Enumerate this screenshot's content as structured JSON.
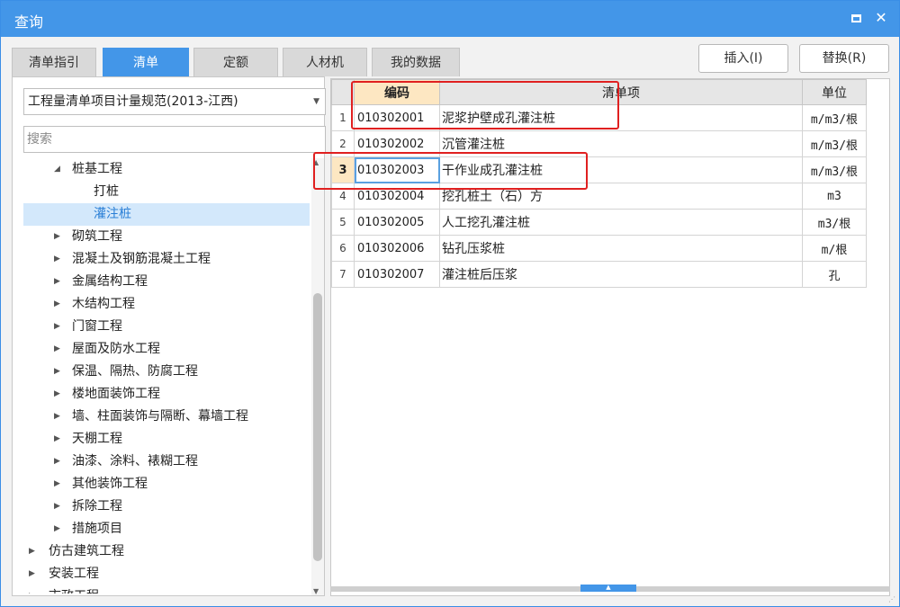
{
  "window": {
    "title": "查询",
    "maximize_label": "",
    "close_label": "✕"
  },
  "tabs": [
    {
      "label": "清单指引",
      "active": false
    },
    {
      "label": "清单",
      "active": true
    },
    {
      "label": "定额",
      "active": false
    },
    {
      "label": "人材机",
      "active": false
    },
    {
      "label": "我的数据",
      "active": false
    }
  ],
  "toolbar": {
    "insert_label": "插入(I)",
    "replace_label": "替换(R)"
  },
  "left": {
    "spec_select_value": "工程量清单项目计量规范(2013-江西)",
    "search_placeholder": "搜索",
    "tree": [
      {
        "label": "桩基工程",
        "expander": "◢",
        "selected": false
      },
      {
        "label": "打桩",
        "expander": "",
        "selected": false
      },
      {
        "label": "灌注桩",
        "expander": "",
        "selected": true
      },
      {
        "label": "砌筑工程",
        "expander": "▶",
        "selected": false
      },
      {
        "label": "混凝土及钢筋混凝土工程",
        "expander": "▶",
        "selected": false
      },
      {
        "label": "金属结构工程",
        "expander": "▶",
        "selected": false
      },
      {
        "label": "木结构工程",
        "expander": "▶",
        "selected": false
      },
      {
        "label": "门窗工程",
        "expander": "▶",
        "selected": false
      },
      {
        "label": "屋面及防水工程",
        "expander": "▶",
        "selected": false
      },
      {
        "label": "保温、隔热、防腐工程",
        "expander": "▶",
        "selected": false
      },
      {
        "label": "楼地面装饰工程",
        "expander": "▶",
        "selected": false
      },
      {
        "label": "墙、柱面装饰与隔断、幕墙工程",
        "expander": "▶",
        "selected": false
      },
      {
        "label": "天棚工程",
        "expander": "▶",
        "selected": false
      },
      {
        "label": "油漆、涂料、裱糊工程",
        "expander": "▶",
        "selected": false
      },
      {
        "label": "其他装饰工程",
        "expander": "▶",
        "selected": false
      },
      {
        "label": "拆除工程",
        "expander": "▶",
        "selected": false
      },
      {
        "label": "措施项目",
        "expander": "▶",
        "selected": false
      },
      {
        "label": "仿古建筑工程",
        "expander": "▶",
        "selected": false
      },
      {
        "label": "安装工程",
        "expander": "▶",
        "selected": false
      },
      {
        "label": "市政工程",
        "expander": "▶",
        "selected": false
      }
    ]
  },
  "table": {
    "columns": {
      "code": "编码",
      "name": "清单项",
      "unit": "单位"
    },
    "current_row": 3,
    "rows": [
      {
        "index": "1",
        "code": "010302001",
        "name": "泥浆护壁成孔灌注桩",
        "unit": "m/m3/根"
      },
      {
        "index": "2",
        "code": "010302002",
        "name": "沉管灌注桩",
        "unit": "m/m3/根"
      },
      {
        "index": "3",
        "code": "010302003",
        "name": "干作业成孔灌注桩",
        "unit": "m/m3/根"
      },
      {
        "index": "4",
        "code": "010302004",
        "name": "挖孔桩土（石）方",
        "unit": "m3"
      },
      {
        "index": "5",
        "code": "010302005",
        "name": "人工挖孔灌注桩",
        "unit": "m3/根"
      },
      {
        "index": "6",
        "code": "010302006",
        "name": "钻孔压浆桩",
        "unit": "m/根"
      },
      {
        "index": "7",
        "code": "010302007",
        "name": "灌注桩后压浆",
        "unit": "孔"
      }
    ]
  },
  "colors": {
    "titlebar": "#4396e8",
    "active_tab": "#4396e8",
    "highlight_border": "#e02020",
    "current_cell": "#fde7c2",
    "selected_tree": "#d3e8fb"
  }
}
